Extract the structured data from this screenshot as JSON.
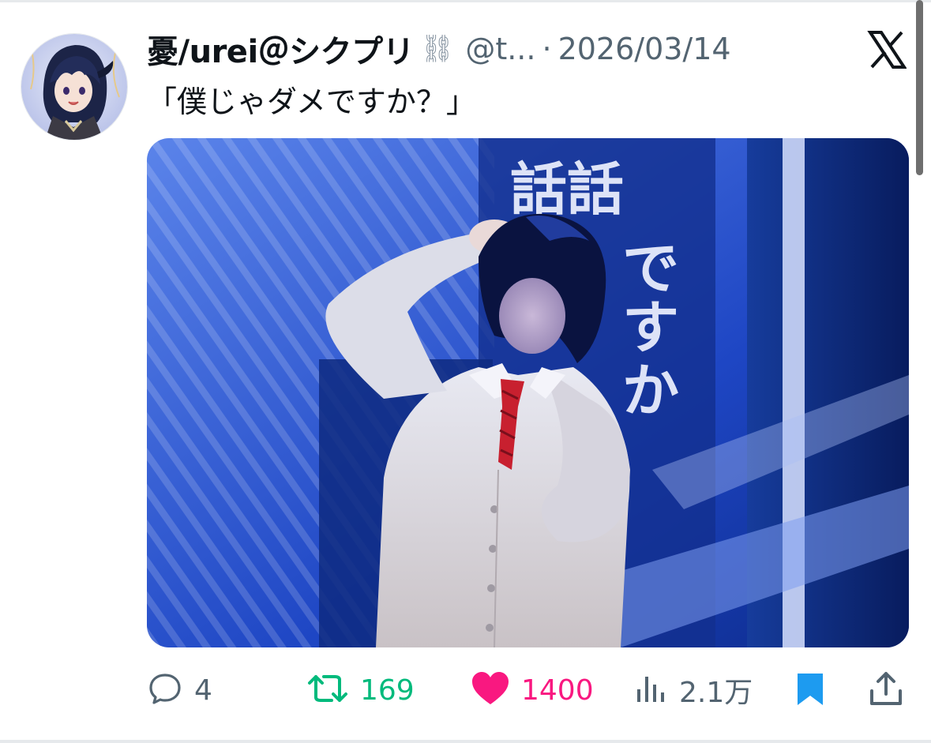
{
  "tweet": {
    "display_name": "憂/urei＠シクプリ",
    "name_emoji": "⛓",
    "handle": "@t...",
    "separator": "·",
    "date": "2026/03/14",
    "text": "「僕じゃダメですか？」",
    "media": {
      "background_text": "話話ですか"
    }
  },
  "actions": {
    "reply_count": "4",
    "retweet_count": "169",
    "like_count": "1400",
    "views_count": "2.1万"
  },
  "colors": {
    "retweet": "#00ba7c",
    "like": "#f91880",
    "bookmark": "#1d9bf0",
    "muted": "#536471",
    "stage_blue": "#1f48c8"
  },
  "icons": {
    "platform": "x-logo-icon",
    "reply": "reply-icon",
    "retweet": "retweet-icon",
    "like": "heart-icon",
    "views": "views-icon",
    "bookmark": "bookmark-icon",
    "share": "share-icon"
  }
}
